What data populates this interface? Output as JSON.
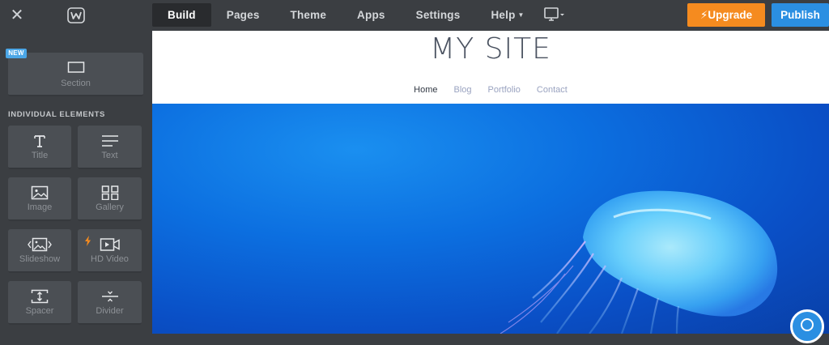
{
  "topbar": {
    "nav": [
      {
        "label": "Build",
        "active": true
      },
      {
        "label": "Pages"
      },
      {
        "label": "Theme"
      },
      {
        "label": "Apps"
      },
      {
        "label": "Settings"
      },
      {
        "label": "Help",
        "caret": true
      }
    ],
    "upgrade_label": "Upgrade",
    "publish_label": "Publish",
    "colors": {
      "upgrade": "#f58b1f",
      "publish": "#2b8fe2"
    }
  },
  "sidebar": {
    "new_badge": "NEW",
    "section_tile": {
      "label": "Section",
      "icon": "section-icon"
    },
    "individual_heading": "INDIVIDUAL ELEMENTS",
    "elements": [
      {
        "label": "Title",
        "icon": "title-icon"
      },
      {
        "label": "Text",
        "icon": "text-icon"
      },
      {
        "label": "Image",
        "icon": "image-icon"
      },
      {
        "label": "Gallery",
        "icon": "gallery-icon"
      },
      {
        "label": "Slideshow",
        "icon": "slideshow-icon"
      },
      {
        "label": "HD Video",
        "icon": "hd-video-icon",
        "premium": true
      },
      {
        "label": "Spacer",
        "icon": "spacer-icon"
      },
      {
        "label": "Divider",
        "icon": "divider-icon"
      }
    ]
  },
  "site": {
    "title": "MY SITE",
    "nav": [
      "Home",
      "Blog",
      "Portfolio",
      "Contact"
    ],
    "current_page": "Home"
  }
}
